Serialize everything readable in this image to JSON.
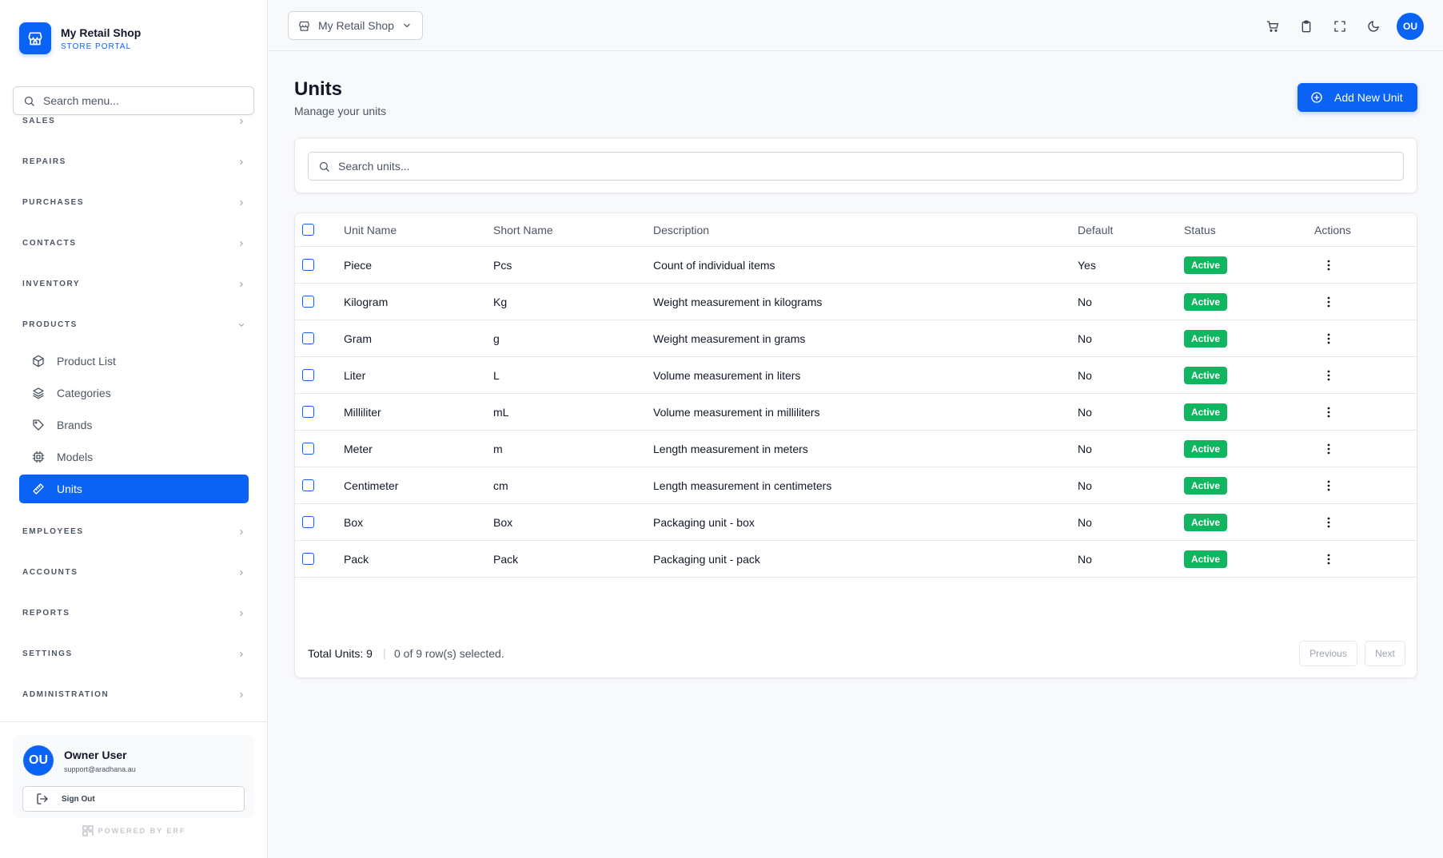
{
  "brand": {
    "name": "My Retail Shop",
    "subtitle": "STORE PORTAL"
  },
  "menu_search": {
    "placeholder": "Search menu..."
  },
  "sidebar": {
    "sections_top": [
      "SALES",
      "REPAIRS",
      "PURCHASES",
      "CONTACTS",
      "INVENTORY"
    ],
    "products": {
      "label": "PRODUCTS",
      "items": [
        {
          "label": "Product List",
          "icon": "box-icon"
        },
        {
          "label": "Categories",
          "icon": "layers-icon"
        },
        {
          "label": "Brands",
          "icon": "tag-icon"
        },
        {
          "label": "Models",
          "icon": "cpu-icon"
        },
        {
          "label": "Units",
          "icon": "ruler-icon",
          "active": true
        }
      ]
    },
    "sections_bottom": [
      "EMPLOYEES",
      "ACCOUNTS",
      "REPORTS",
      "SETTINGS",
      "ADMINISTRATION"
    ]
  },
  "user": {
    "initials": "OU",
    "name": "Owner User",
    "email": "support@aradhana.au",
    "signout_label": "Sign Out"
  },
  "powered_by": "POWERED BY ERF",
  "header": {
    "shop_selector": "My Retail Shop",
    "icons": [
      "cart-icon",
      "clipboard-icon",
      "fullscreen-icon",
      "moon-icon"
    ],
    "avatar_initials": "OU"
  },
  "page": {
    "title": "Units",
    "subtitle": "Manage your units",
    "add_button": "Add New Unit"
  },
  "search": {
    "placeholder": "Search units..."
  },
  "table": {
    "columns": [
      "Unit Name",
      "Short Name",
      "Description",
      "Default",
      "Status",
      "Actions"
    ],
    "rows": [
      {
        "name": "Piece",
        "short": "Pcs",
        "description": "Count of individual items",
        "default": "Yes",
        "status": "Active"
      },
      {
        "name": "Kilogram",
        "short": "Kg",
        "description": "Weight measurement in kilograms",
        "default": "No",
        "status": "Active"
      },
      {
        "name": "Gram",
        "short": "g",
        "description": "Weight measurement in grams",
        "default": "No",
        "status": "Active"
      },
      {
        "name": "Liter",
        "short": "L",
        "description": "Volume measurement in liters",
        "default": "No",
        "status": "Active"
      },
      {
        "name": "Milliliter",
        "short": "mL",
        "description": "Volume measurement in milliliters",
        "default": "No",
        "status": "Active"
      },
      {
        "name": "Meter",
        "short": "m",
        "description": "Length measurement in meters",
        "default": "No",
        "status": "Active"
      },
      {
        "name": "Centimeter",
        "short": "cm",
        "description": "Length measurement in centimeters",
        "default": "No",
        "status": "Active"
      },
      {
        "name": "Box",
        "short": "Box",
        "description": "Packaging unit - box",
        "default": "No",
        "status": "Active"
      },
      {
        "name": "Pack",
        "short": "Pack",
        "description": "Packaging unit - pack",
        "default": "No",
        "status": "Active"
      }
    ],
    "footer": {
      "total": "Total Units: 9",
      "selected": "0 of 9 row(s) selected.",
      "previous": "Previous",
      "next": "Next"
    }
  },
  "colors": {
    "accent": "#0b63f6",
    "status_active": "#10b55f"
  }
}
